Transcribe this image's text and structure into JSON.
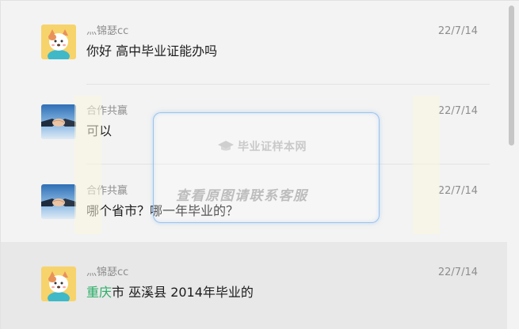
{
  "conversations": [
    {
      "name": "灬锦瑟cc",
      "message_prefix": "",
      "message_text": "你好  高中毕业证能办吗",
      "date": "22/7/14",
      "avatar": "cartoon-dog-avatar"
    },
    {
      "name": "合作共赢",
      "message_prefix": "",
      "message_text": "可以",
      "date": "22/7/14",
      "avatar": "handshake-avatar"
    },
    {
      "name": "合作共赢",
      "message_prefix": "",
      "message_text": "哪个省市？哪一年毕业的？",
      "date": "22/7/14",
      "avatar": "handshake-avatar"
    },
    {
      "name": "灬锦瑟cc",
      "message_prefix": "重庆",
      "message_text": "市 巫溪县 2014年毕业的",
      "date": "22/7/14",
      "avatar": "cartoon-dog-avatar"
    }
  ],
  "watermark": {
    "logo_text": "毕业证样本网",
    "contact_text": "查看原图请联系客服",
    "icon": "graduation-cap-icon"
  },
  "colors": {
    "background": "#f3f3f3",
    "selected_row": "#e8e8e8",
    "highlight_text": "#2aae67",
    "meta_text": "#8d8d8d"
  }
}
